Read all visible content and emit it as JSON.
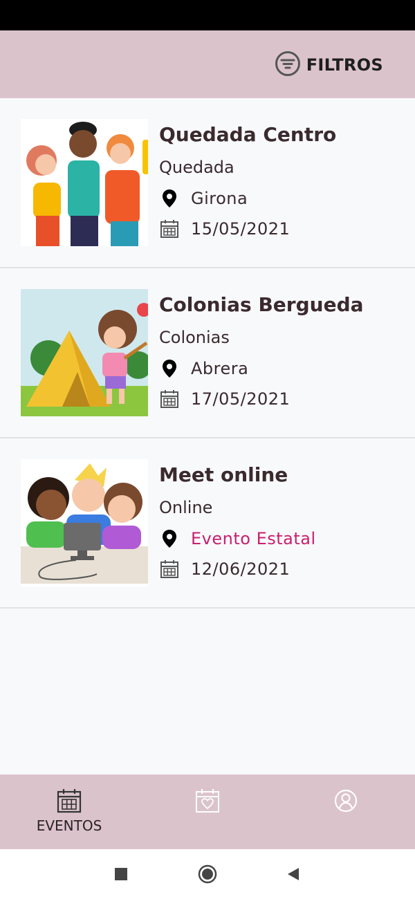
{
  "header": {
    "filter_label": "FILTROS",
    "filter_icon": "filter-icon"
  },
  "events": [
    {
      "title": "Quedada Centro",
      "type": "Quedada",
      "location": "Girona",
      "date": "15/05/2021",
      "image": "group-of-friends-illustration"
    },
    {
      "title": "Colonias Bergueda",
      "type": "Colonias",
      "location": "Abrera",
      "date": "17/05/2021",
      "image": "camping-tent-child-illustration"
    },
    {
      "title": "Meet online",
      "type": "Online",
      "location": "Evento Estatal",
      "date": "12/06/2021",
      "image": "kids-at-computer-illustration"
    }
  ],
  "bottom_nav": {
    "items": [
      {
        "label": "EVENTOS",
        "icon": "calendar-icon",
        "active": true
      },
      {
        "label": "",
        "icon": "calendar-heart-icon",
        "active": false
      },
      {
        "label": "",
        "icon": "profile-icon",
        "active": false
      }
    ]
  },
  "system_nav": [
    "square-button",
    "home-button",
    "back-button"
  ],
  "colors": {
    "header_bg": "#dbc3cc",
    "highlight": "#c91f6f",
    "text": "#3a2a2e"
  }
}
